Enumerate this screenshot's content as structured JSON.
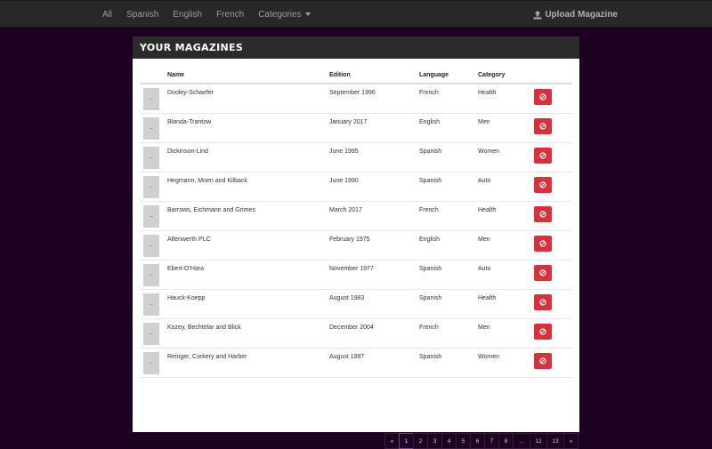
{
  "navbar": {
    "links": [
      "All",
      "Spanish",
      "English",
      "French",
      "Categories"
    ],
    "upload_label": "Upload Magazine"
  },
  "panel": {
    "title": "YOUR MAGAZINES"
  },
  "table": {
    "headers": [
      "Name",
      "Edition",
      "Language",
      "Category"
    ],
    "rows": [
      {
        "name": "Dooley-Schaefer",
        "edition": "September 1996",
        "language": "French",
        "category": "Health"
      },
      {
        "name": "Blanda-Trantow",
        "edition": "January 2017",
        "language": "English",
        "category": "Men"
      },
      {
        "name": "Dickinson-Lind",
        "edition": "June 1995",
        "language": "Spanish",
        "category": "Women"
      },
      {
        "name": "Hegmann, Moen and Kilback",
        "edition": "June 1990",
        "language": "Spanish",
        "category": "Auto"
      },
      {
        "name": "Barrows, Eichmann and Grimes",
        "edition": "March 2017",
        "language": "French",
        "category": "Health"
      },
      {
        "name": "Altenwerth PLC",
        "edition": "February 1975",
        "language": "English",
        "category": "Men"
      },
      {
        "name": "Ebert-O'Hara",
        "edition": "November 1977",
        "language": "Spanish",
        "category": "Auto"
      },
      {
        "name": "Hauck-Koepp",
        "edition": "August 1983",
        "language": "Spanish",
        "category": "Health"
      },
      {
        "name": "Kozey, Bechtelar and Blick",
        "edition": "December 2004",
        "language": "French",
        "category": "Men"
      },
      {
        "name": "Reinger, Corkery and Harber",
        "edition": "August 1997",
        "language": "Spanish",
        "category": "Women"
      }
    ]
  },
  "pagination": {
    "items": [
      "«",
      "1",
      "2",
      "3",
      "4",
      "5",
      "6",
      "7",
      "8",
      "...",
      "12",
      "13",
      "»"
    ],
    "active": "1"
  },
  "colors": {
    "background": "#1c0220",
    "navbar": "#282828",
    "delete_button": "#d9303a"
  },
  "icons": {
    "upload": "upload-icon",
    "delete": "ban-icon",
    "dropdown": "caret-down-icon"
  }
}
